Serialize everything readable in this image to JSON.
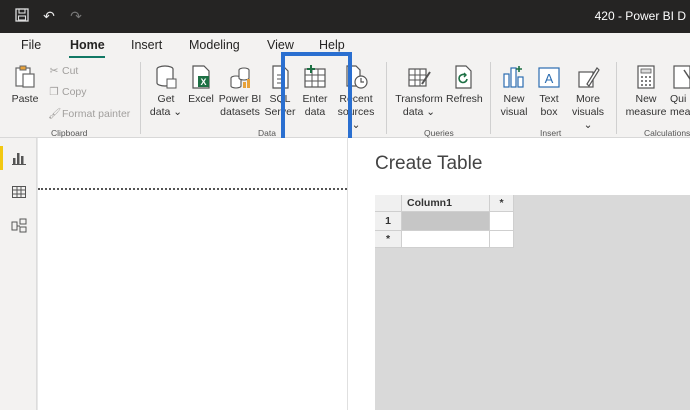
{
  "window": {
    "title": "420 - Power BI D"
  },
  "menu": [
    {
      "label": "File",
      "active": false
    },
    {
      "label": "Home",
      "active": true
    },
    {
      "label": "Insert",
      "active": false
    },
    {
      "label": "Modeling",
      "active": false
    },
    {
      "label": "View",
      "active": false
    },
    {
      "label": "Help",
      "active": false
    }
  ],
  "ribbon": {
    "clipboard": {
      "paste": "Paste",
      "cut": "Cut",
      "copy": "Copy",
      "format_painter": "Format painter",
      "group": "Clipboard"
    },
    "data": {
      "get_data_1": "Get",
      "get_data_2": "data ⌄",
      "excel": "Excel",
      "pbi_1": "Power BI",
      "pbi_2": "datasets",
      "sql_1": "SQL",
      "sql_2": "Server",
      "enter_1": "Enter",
      "enter_2": "data",
      "recent_1": "Recent",
      "recent_2": "sources ⌄",
      "group": "Data"
    },
    "queries": {
      "transform_1": "Transform",
      "transform_2": "data ⌄",
      "refresh": "Refresh",
      "group": "Queries"
    },
    "insert": {
      "newvisual_1": "New",
      "newvisual_2": "visual",
      "textbox_1": "Text",
      "textbox_2": "box",
      "more_1": "More",
      "more_2": "visuals ⌄",
      "group": "Insert"
    },
    "calculations": {
      "newmeasure_1": "New",
      "newmeasure_2": "measure",
      "quick_1": "Qui",
      "quick_2": "meas",
      "group": "Calculations"
    }
  },
  "dialog": {
    "title": "Create Table",
    "column_header": "Column1",
    "add_col": "*",
    "row1": "1",
    "newrow": "*"
  },
  "colors": {
    "accent": "#117865",
    "highlight": "#2a6fd0",
    "nav_active": "#f2c811"
  }
}
